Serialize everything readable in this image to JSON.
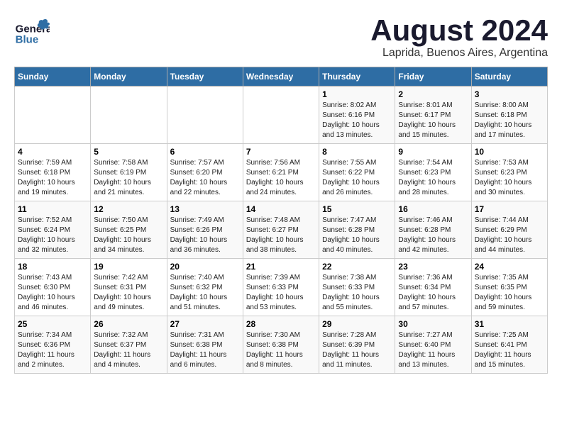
{
  "header": {
    "logo_general": "General",
    "logo_blue": "Blue",
    "title": "August 2024",
    "subtitle": "Laprida, Buenos Aires, Argentina"
  },
  "weekdays": [
    "Sunday",
    "Monday",
    "Tuesday",
    "Wednesday",
    "Thursday",
    "Friday",
    "Saturday"
  ],
  "weeks": [
    [
      {
        "day": "",
        "info": ""
      },
      {
        "day": "",
        "info": ""
      },
      {
        "day": "",
        "info": ""
      },
      {
        "day": "",
        "info": ""
      },
      {
        "day": "1",
        "info": "Sunrise: 8:02 AM\nSunset: 6:16 PM\nDaylight: 10 hours\nand 13 minutes."
      },
      {
        "day": "2",
        "info": "Sunrise: 8:01 AM\nSunset: 6:17 PM\nDaylight: 10 hours\nand 15 minutes."
      },
      {
        "day": "3",
        "info": "Sunrise: 8:00 AM\nSunset: 6:18 PM\nDaylight: 10 hours\nand 17 minutes."
      }
    ],
    [
      {
        "day": "4",
        "info": "Sunrise: 7:59 AM\nSunset: 6:18 PM\nDaylight: 10 hours\nand 19 minutes."
      },
      {
        "day": "5",
        "info": "Sunrise: 7:58 AM\nSunset: 6:19 PM\nDaylight: 10 hours\nand 21 minutes."
      },
      {
        "day": "6",
        "info": "Sunrise: 7:57 AM\nSunset: 6:20 PM\nDaylight: 10 hours\nand 22 minutes."
      },
      {
        "day": "7",
        "info": "Sunrise: 7:56 AM\nSunset: 6:21 PM\nDaylight: 10 hours\nand 24 minutes."
      },
      {
        "day": "8",
        "info": "Sunrise: 7:55 AM\nSunset: 6:22 PM\nDaylight: 10 hours\nand 26 minutes."
      },
      {
        "day": "9",
        "info": "Sunrise: 7:54 AM\nSunset: 6:23 PM\nDaylight: 10 hours\nand 28 minutes."
      },
      {
        "day": "10",
        "info": "Sunrise: 7:53 AM\nSunset: 6:23 PM\nDaylight: 10 hours\nand 30 minutes."
      }
    ],
    [
      {
        "day": "11",
        "info": "Sunrise: 7:52 AM\nSunset: 6:24 PM\nDaylight: 10 hours\nand 32 minutes."
      },
      {
        "day": "12",
        "info": "Sunrise: 7:50 AM\nSunset: 6:25 PM\nDaylight: 10 hours\nand 34 minutes."
      },
      {
        "day": "13",
        "info": "Sunrise: 7:49 AM\nSunset: 6:26 PM\nDaylight: 10 hours\nand 36 minutes."
      },
      {
        "day": "14",
        "info": "Sunrise: 7:48 AM\nSunset: 6:27 PM\nDaylight: 10 hours\nand 38 minutes."
      },
      {
        "day": "15",
        "info": "Sunrise: 7:47 AM\nSunset: 6:28 PM\nDaylight: 10 hours\nand 40 minutes."
      },
      {
        "day": "16",
        "info": "Sunrise: 7:46 AM\nSunset: 6:28 PM\nDaylight: 10 hours\nand 42 minutes."
      },
      {
        "day": "17",
        "info": "Sunrise: 7:44 AM\nSunset: 6:29 PM\nDaylight: 10 hours\nand 44 minutes."
      }
    ],
    [
      {
        "day": "18",
        "info": "Sunrise: 7:43 AM\nSunset: 6:30 PM\nDaylight: 10 hours\nand 46 minutes."
      },
      {
        "day": "19",
        "info": "Sunrise: 7:42 AM\nSunset: 6:31 PM\nDaylight: 10 hours\nand 49 minutes."
      },
      {
        "day": "20",
        "info": "Sunrise: 7:40 AM\nSunset: 6:32 PM\nDaylight: 10 hours\nand 51 minutes."
      },
      {
        "day": "21",
        "info": "Sunrise: 7:39 AM\nSunset: 6:33 PM\nDaylight: 10 hours\nand 53 minutes."
      },
      {
        "day": "22",
        "info": "Sunrise: 7:38 AM\nSunset: 6:33 PM\nDaylight: 10 hours\nand 55 minutes."
      },
      {
        "day": "23",
        "info": "Sunrise: 7:36 AM\nSunset: 6:34 PM\nDaylight: 10 hours\nand 57 minutes."
      },
      {
        "day": "24",
        "info": "Sunrise: 7:35 AM\nSunset: 6:35 PM\nDaylight: 10 hours\nand 59 minutes."
      }
    ],
    [
      {
        "day": "25",
        "info": "Sunrise: 7:34 AM\nSunset: 6:36 PM\nDaylight: 11 hours\nand 2 minutes."
      },
      {
        "day": "26",
        "info": "Sunrise: 7:32 AM\nSunset: 6:37 PM\nDaylight: 11 hours\nand 4 minutes."
      },
      {
        "day": "27",
        "info": "Sunrise: 7:31 AM\nSunset: 6:38 PM\nDaylight: 11 hours\nand 6 minutes."
      },
      {
        "day": "28",
        "info": "Sunrise: 7:30 AM\nSunset: 6:38 PM\nDaylight: 11 hours\nand 8 minutes."
      },
      {
        "day": "29",
        "info": "Sunrise: 7:28 AM\nSunset: 6:39 PM\nDaylight: 11 hours\nand 11 minutes."
      },
      {
        "day": "30",
        "info": "Sunrise: 7:27 AM\nSunset: 6:40 PM\nDaylight: 11 hours\nand 13 minutes."
      },
      {
        "day": "31",
        "info": "Sunrise: 7:25 AM\nSunset: 6:41 PM\nDaylight: 11 hours\nand 15 minutes."
      }
    ]
  ]
}
